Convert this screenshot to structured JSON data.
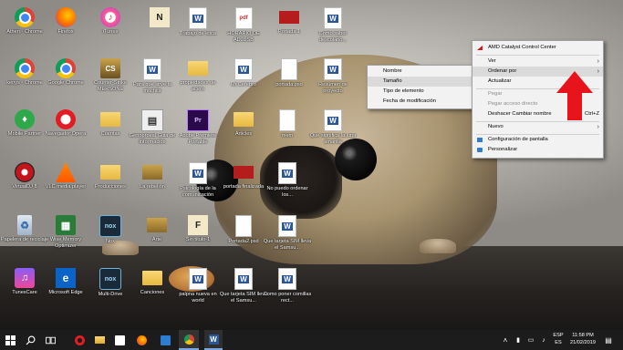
{
  "desktop_icons": [
    {
      "label": "Athen - Chrome",
      "icon": "chrome-icon"
    },
    {
      "label": "Firefox",
      "icon": "firefox-icon"
    },
    {
      "label": "iTunes",
      "icon": "itunes-icon"
    },
    {
      "label": "",
      "icon": "notion-icon"
    },
    {
      "label": "Trabajo de etica",
      "icon": "word-doc-icon"
    },
    {
      "label": "HORARIO DE ADJUSB",
      "icon": "pdf-file-icon"
    },
    {
      "label": "Portada 1",
      "icon": "red-image-icon"
    },
    {
      "label": "Como saber descolario...",
      "icon": "word-doc-icon"
    },
    {
      "label": "kenys - Chrome",
      "icon": "chrome-icon"
    },
    {
      "label": "Google Chrome",
      "icon": "chrome-icon"
    },
    {
      "label": "Counter-Strike MERSONE",
      "icon": "counter-strike-icon"
    },
    {
      "label": "Para que sirve la mochila",
      "icon": "word-doc-icon"
    },
    {
      "label": "propiedades de acero",
      "icon": "folder-icon"
    },
    {
      "label": "Mr.Cerebro",
      "icon": "word-doc-icon"
    },
    {
      "label": "portada.psd",
      "icon": "file-icon"
    },
    {
      "label": "Resumen de proyecto",
      "icon": "word-doc-icon"
    },
    {
      "label": "Mobile Partner",
      "icon": "mobile-partner-icon"
    },
    {
      "label": "Navegador Opera",
      "icon": "opera-icon"
    },
    {
      "label": "Cuentas",
      "icon": "folder-icon"
    },
    {
      "label": "Genoproeal Guia de Información",
      "icon": "genoslide-icon"
    },
    {
      "label": "Adobe Premiere Portable",
      "icon": "premiere-icon"
    },
    {
      "label": "Articles",
      "icon": "folder-icon"
    },
    {
      "label": "mem",
      "icon": "file-icon"
    },
    {
      "label": "Que significa la luna amarilla",
      "icon": "word-doc-icon"
    },
    {
      "label": "VirtualDJ 8",
      "icon": "virtualdj-icon"
    },
    {
      "label": "VLC media player",
      "icon": "vlc-icon"
    },
    {
      "label": "Producciones",
      "icon": "folder-icon"
    },
    {
      "label": "La rebelión",
      "icon": "folder-dark-icon"
    },
    {
      "label": "Psicología de la comunicación",
      "icon": "word-doc-icon"
    },
    {
      "label": "portada finalizada",
      "icon": "red-image-icon"
    },
    {
      "label": "No puedo ordenar los...",
      "icon": "word-doc-icon"
    },
    {
      "label": "Papelera de reciclaje",
      "icon": "recycle-bin-icon"
    },
    {
      "label": "Wise Memory Optimizer",
      "icon": "wise-memory-icon"
    },
    {
      "label": "Nox",
      "icon": "nox-icon"
    },
    {
      "label": "Arte",
      "icon": "folder-dark-icon"
    },
    {
      "label": "Sin titulo-1",
      "icon": "notion-icon"
    },
    {
      "label": "Portada2.psd",
      "icon": "file-icon"
    },
    {
      "label": "Que tarjeta SIM lleva el Samsu...",
      "icon": "word-doc-icon"
    },
    {
      "label": "TunesCare",
      "icon": "tunescare-icon"
    },
    {
      "label": "Microsoft Edge",
      "icon": "edge-icon"
    },
    {
      "label": "Multi-Drive",
      "icon": "nox-icon"
    },
    {
      "label": "Canciones",
      "icon": "folder-icon"
    },
    {
      "label": "palpna nueva en world",
      "icon": "word-doc-icon"
    },
    {
      "label": "Que tarjeta SIM lleva el Samsu...",
      "icon": "word-doc-icon"
    },
    {
      "label": "Como poner comillas rect...",
      "icon": "word-doc-icon"
    }
  ],
  "context_menu": {
    "items": [
      {
        "label": "AMD Catalyst Control Center",
        "state": "normal"
      },
      {
        "label": "Ver",
        "state": "submenu"
      },
      {
        "label": "Ordenar por",
        "state": "highlighted-submenu"
      },
      {
        "label": "Actualizar",
        "state": "normal"
      },
      {
        "label": "Pegar",
        "state": "disabled"
      },
      {
        "label": "Pegar acceso directo",
        "state": "disabled"
      },
      {
        "label": "Deshacer Cambiar nombre",
        "shortcut": "Ctrl+Z",
        "state": "normal"
      },
      {
        "label": "Nuevo",
        "state": "submenu"
      },
      {
        "label": "Configuración de pantalla",
        "state": "normal"
      },
      {
        "label": "Personalizar",
        "state": "normal"
      }
    ]
  },
  "sort_submenu": {
    "items": [
      {
        "label": "Nombre",
        "state": "normal"
      },
      {
        "label": "Tamaño",
        "state": "highlighted"
      },
      {
        "label": "Tipo de elemento",
        "state": "normal"
      },
      {
        "label": "Fecha de modificación",
        "state": "normal"
      }
    ]
  },
  "taskbar": {
    "pinned": [
      "start-icon",
      "search-icon",
      "task-view-icon",
      "opera-icon",
      "files-icon",
      "store-icon",
      "firefox-icon",
      "chrome-icon",
      "settings-icon",
      "word-icon"
    ],
    "language": "ESP",
    "locale": "ES",
    "time": "11:58 PM",
    "date": "21/02/2019"
  },
  "colors": {
    "taskbar": "#1c1c1c",
    "menu_bg": "#f2f2f2",
    "menu_highlight": "#dadada",
    "arrow": "#e8141c",
    "word_blue": "#2b579a"
  }
}
